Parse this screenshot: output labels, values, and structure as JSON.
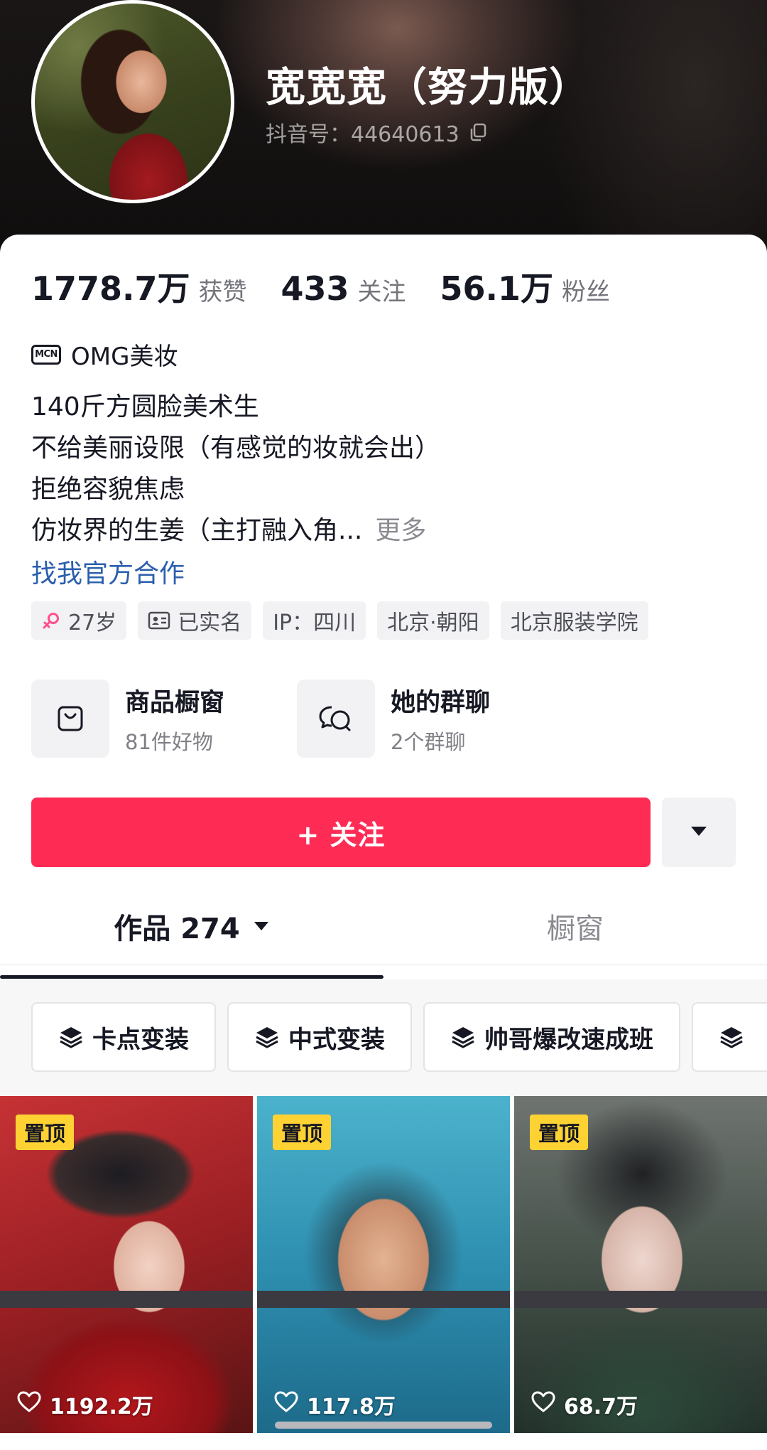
{
  "profile": {
    "name": "宽宽宽（努力版）",
    "douyin_id": "抖音号：44640613"
  },
  "stats": [
    {
      "value": "1778.7万",
      "label": "获赞"
    },
    {
      "value": "433",
      "label": "关注"
    },
    {
      "value": "56.1万",
      "label": "粉丝"
    }
  ],
  "mcn": {
    "badge": "MCN",
    "name": "OMG美妆"
  },
  "bio": {
    "lines": [
      "140斤方圆脸美术生",
      "不给美丽设限（有感觉的妆就会出）",
      "拒绝容貌焦虑",
      "仿妆界的生姜（主打融入角..."
    ],
    "more": "更多"
  },
  "contact_link": "找我官方合作",
  "tags": [
    {
      "icon": "female-icon",
      "label": "27岁"
    },
    {
      "icon": "id-card-icon",
      "label": "已实名"
    },
    {
      "icon": "",
      "label": "IP：四川"
    },
    {
      "icon": "",
      "label": "北京·朝阳"
    },
    {
      "icon": "",
      "label": "北京服装学院"
    }
  ],
  "entries": [
    {
      "icon": "shopping-bag-icon",
      "title": "商品橱窗",
      "subtitle": "81件好物"
    },
    {
      "icon": "group-chat-icon",
      "title": "她的群聊",
      "subtitle": "2个群聊"
    }
  ],
  "actions": {
    "follow": "+ 关注"
  },
  "tabs": [
    {
      "label": "作品 274",
      "active": true
    },
    {
      "label": "橱窗",
      "active": false
    }
  ],
  "collections": [
    "卡点变装",
    "中式变装",
    "帅哥爆改速成班"
  ],
  "videos": [
    {
      "pin": "置顶",
      "likes": "1192.2万"
    },
    {
      "pin": "置顶",
      "likes": "117.8万"
    },
    {
      "pin": "置顶",
      "likes": "68.7万"
    }
  ],
  "colors": {
    "accent": "#fe2c55",
    "link": "#2b5fad",
    "pin_badge": "#ffd233",
    "text_primary": "#161823"
  }
}
